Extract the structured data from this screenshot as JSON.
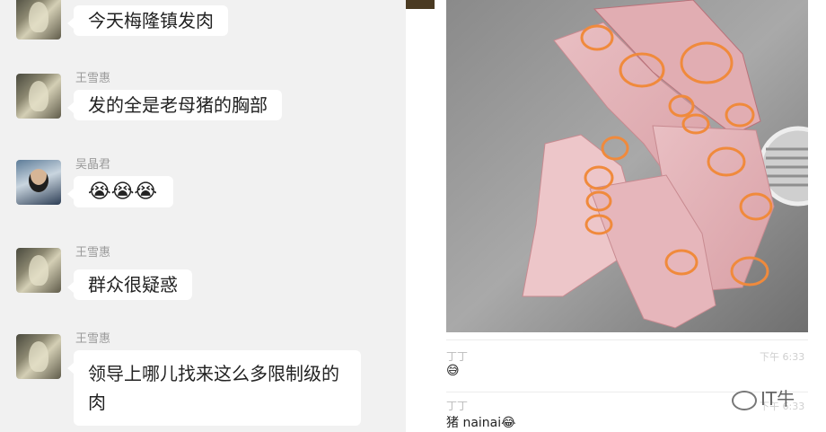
{
  "chat": {
    "messages": [
      {
        "sender": "",
        "text": "今天梅隆镇发肉"
      },
      {
        "sender": "王雪惠",
        "text": "发的全是老母猪的胸部"
      },
      {
        "sender": "吴晶君",
        "text": "😭😭😭"
      },
      {
        "sender": "王雪惠",
        "text": "群众很疑惑"
      },
      {
        "sender": "王雪惠",
        "text": "领导上哪儿找来这么多限制级的肉"
      }
    ]
  },
  "right": {
    "comments": [
      {
        "name": "丁丁",
        "time": "下午 6:33",
        "text": "😅"
      },
      {
        "name": "丁丁",
        "time": "下午 6:33",
        "text": "猪 nainai😂"
      }
    ],
    "watermark": "IT牛"
  },
  "colors": {
    "left_bg": "#f1f1f1",
    "bubble": "#ffffff",
    "circle": "#f08a3c"
  }
}
